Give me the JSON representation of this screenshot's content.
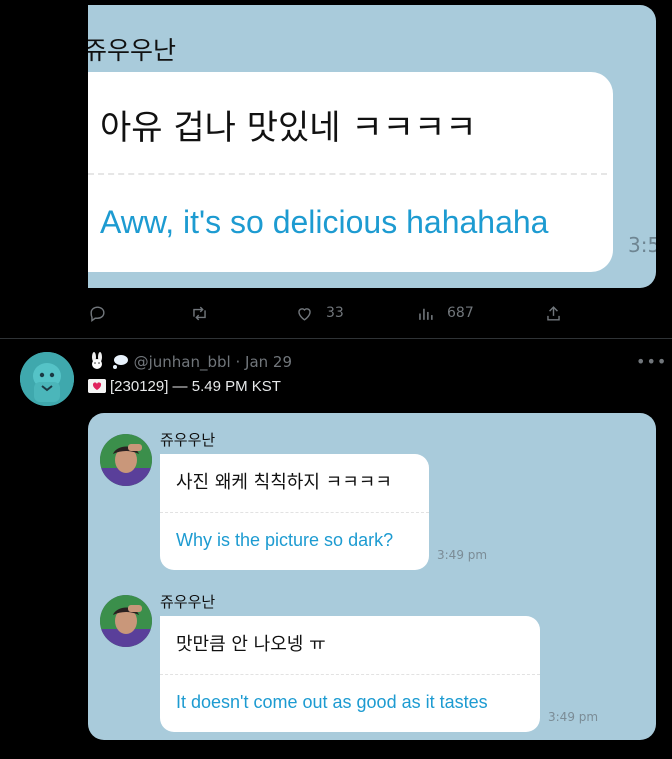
{
  "tweet1": {
    "image": {
      "sender": "쥬우우난",
      "korean": "아유 겁나 맛있네 ㅋㅋㅋㅋ",
      "english": "Aww, it's so delicious hahahaha",
      "time_partial": "3:5"
    },
    "actions": {
      "likes": "33",
      "views": "687"
    }
  },
  "tweet2": {
    "handle": "@junhan_bbl",
    "separator": "·",
    "date": "Jan 29",
    "text": "[230129] — 5.49 PM KST",
    "messages": [
      {
        "sender": "쥬우우난",
        "korean": "사진 왜케 칙칙하지 ㅋㅋㅋㅋ",
        "english": "Why is the picture so dark?",
        "time": "3:49 pm"
      },
      {
        "sender": "쥬우우난",
        "korean": "맛만큼 안 나오넹 ㅠ",
        "english": "It doesn't come out as good as it tastes",
        "time": "3:49 pm"
      }
    ]
  },
  "colors": {
    "background": "#000000",
    "image_bg": "#a9cbdb",
    "translation_blue": "#1d9bd1",
    "muted": "#71767b",
    "avatar_teal": "#3fa8ad"
  },
  "icons": [
    "reply-icon",
    "retweet-icon",
    "like-icon",
    "views-icon",
    "share-icon",
    "more-icon",
    "bunny-emoji-icon",
    "thought-bubble-emoji-icon",
    "love-letter-emoji-icon"
  ]
}
